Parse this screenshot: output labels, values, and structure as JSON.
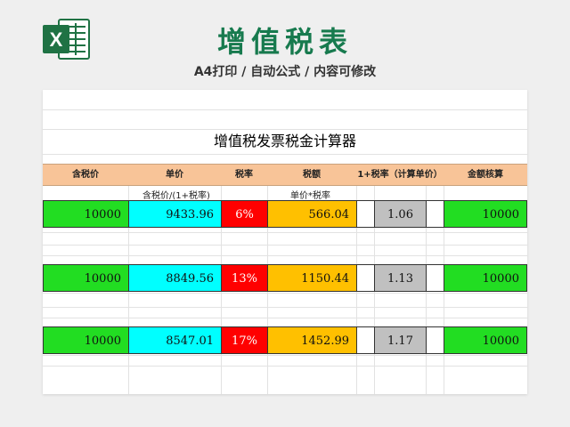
{
  "header": {
    "title": "增值税表",
    "subtitle": "A4打印 / 自动公式 / 内容可修改",
    "logo_letter": "X"
  },
  "sheet": {
    "title": "增值税发票税金计算器",
    "columns": [
      "含税价",
      "单价",
      "税率",
      "税额",
      "1+税率（计算单价）",
      "金额核算"
    ],
    "notes": {
      "price_formula": "含税价/(1+税率)",
      "tax_formula": "单价*税率"
    },
    "rows": [
      {
        "gross": "10000",
        "unit": "9433.96",
        "rate": "6%",
        "tax": "566.04",
        "factor": "1.06",
        "check": "10000"
      },
      {
        "gross": "10000",
        "unit": "8849.56",
        "rate": "13%",
        "tax": "1150.44",
        "factor": "1.13",
        "check": "10000"
      },
      {
        "gross": "10000",
        "unit": "8547.01",
        "rate": "17%",
        "tax": "1452.99",
        "factor": "1.17",
        "check": "10000"
      }
    ]
  },
  "colors": {
    "brand_green": "#177a4e",
    "header_fill": "#f8c498",
    "gross_fill": "#22dd22",
    "unit_fill": "#00ffff",
    "rate_fill": "#ff0000",
    "tax_fill": "#ffc000",
    "factor_fill": "#c0c0c0"
  }
}
